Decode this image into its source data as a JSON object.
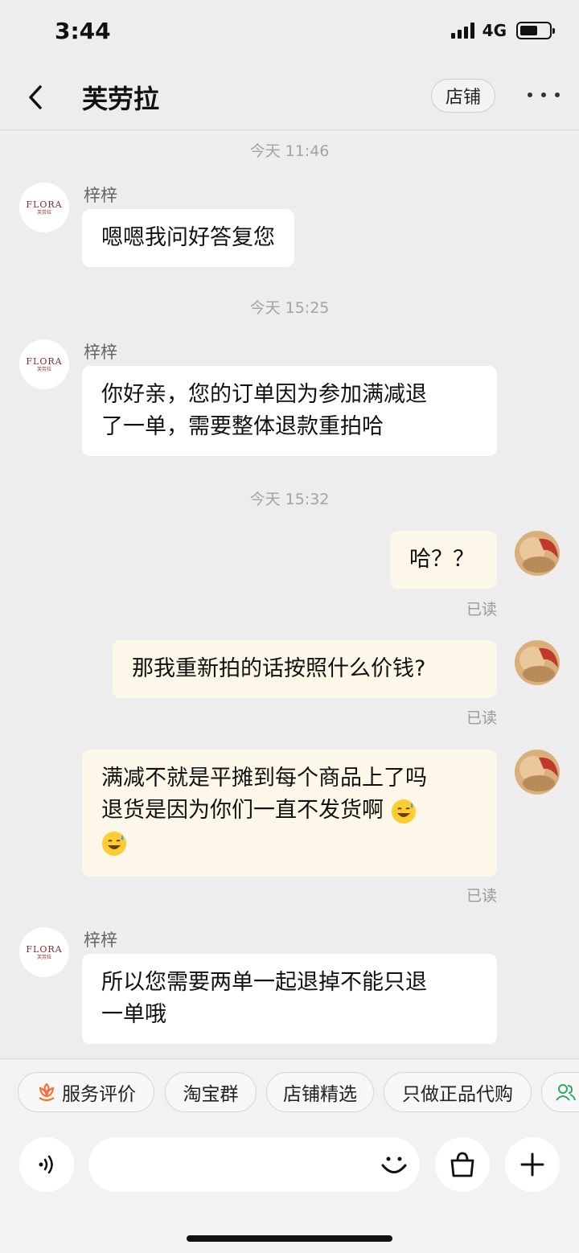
{
  "status_bar": {
    "time": "3:44",
    "network": "4G"
  },
  "header": {
    "title": "芙劳拉",
    "store_button": "店铺"
  },
  "merchant": {
    "logo_text": "FLORA",
    "logo_sub": "芙劳拉"
  },
  "messages": {
    "t1": "今天 11:46",
    "m1_sender": "梓梓",
    "m1_text": "嗯嗯我问好答复您",
    "t2": "今天 15:25",
    "m2_sender": "梓梓",
    "m2_line1": "你好亲，您的订单因为参加满减退",
    "m2_line2": "了一单，需要整体退款重拍哈",
    "t3": "今天 15:32",
    "m3_text": "哈？？",
    "m3_status": "已读",
    "m4_text": "那我重新拍的话按照什么价钱?",
    "m4_status": "已读",
    "m5_line1": "满减不就是平摊到每个商品上了吗",
    "m5_line2": " 退货是因为你们一直不发货啊",
    "m5_status": "已读",
    "m6_sender": "梓梓",
    "m6_line1": "所以您需要两单一起退掉不能只退",
    "m6_line2": "一单哦"
  },
  "quick_replies": [
    "服务评价",
    "淘宝群",
    "店铺精选",
    "只做正品代购"
  ],
  "icons": {
    "back": "chevron-left-icon",
    "more": "more-dots-icon",
    "voice": "voice-icon",
    "emoji": "smile-icon",
    "bag": "shopping-bag-icon",
    "plus": "plus-icon",
    "service": "flower-icon",
    "group": "people-icon"
  },
  "colors": {
    "background": "#ededed",
    "my_bubble": "#fdf7e9",
    "their_bubble": "#ffffff",
    "accent": "#ff6a2b"
  }
}
